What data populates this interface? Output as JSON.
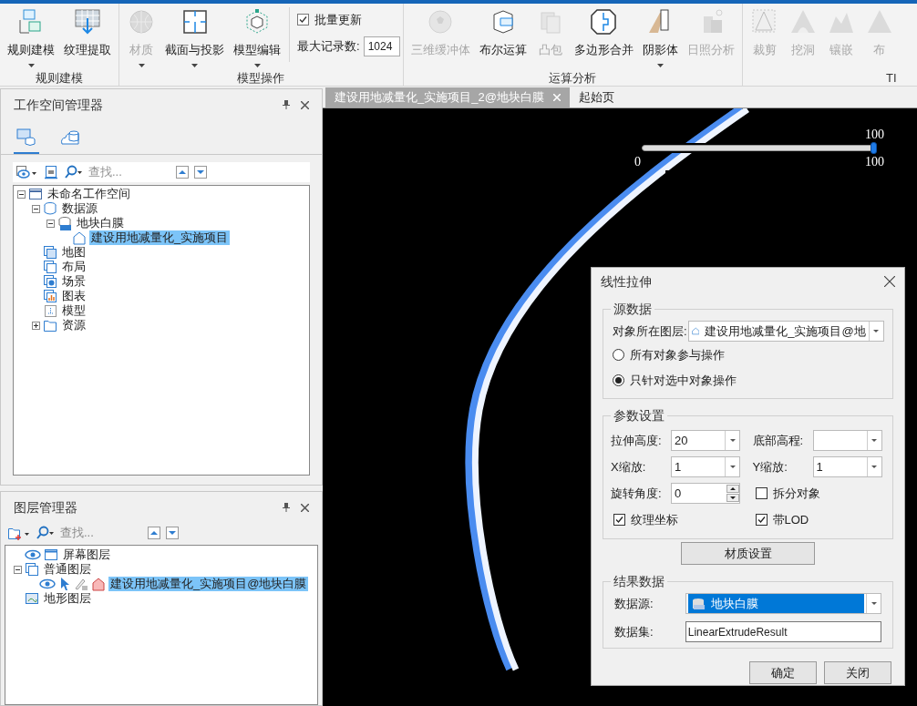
{
  "ribbon": {
    "groups": [
      {
        "label": "规则建模",
        "buttons": [
          {
            "label": "规则建模",
            "disabled": false,
            "dropdown": true
          },
          {
            "label": "纹理提取",
            "disabled": false,
            "dropdown": false
          }
        ]
      },
      {
        "label": "模型操作",
        "buttons": [
          {
            "label": "材质",
            "disabled": true,
            "dropdown": true
          },
          {
            "label": "截面与投影",
            "disabled": false,
            "dropdown": true
          },
          {
            "label": "模型编辑",
            "disabled": false,
            "dropdown": true
          }
        ],
        "batch_update": {
          "label": "批量更新",
          "checked": true
        },
        "max_records": {
          "label": "最大记录数:",
          "value": "1024"
        }
      },
      {
        "label": "运算分析",
        "buttons": [
          {
            "label": "三维缓冲体",
            "disabled": true,
            "dropdown": false
          },
          {
            "label": "布尔运算",
            "disabled": false,
            "dropdown": false
          },
          {
            "label": "凸包",
            "disabled": true,
            "dropdown": false
          },
          {
            "label": "多边形合并",
            "disabled": false,
            "dropdown": false
          },
          {
            "label": "阴影体",
            "disabled": false,
            "dropdown": true
          },
          {
            "label": "日照分析",
            "disabled": true,
            "dropdown": false
          }
        ]
      },
      {
        "label": "TI",
        "buttons": [
          {
            "label": "裁剪",
            "disabled": true,
            "dropdown": false
          },
          {
            "label": "挖洞",
            "disabled": true,
            "dropdown": false
          },
          {
            "label": "镶嵌",
            "disabled": true,
            "dropdown": false
          },
          {
            "label": "布",
            "disabled": true,
            "dropdown": false
          }
        ]
      }
    ]
  },
  "workspace_panel": {
    "title": "工作空间管理器",
    "view_tabs": [
      {
        "selected": true
      },
      {
        "selected": false
      }
    ],
    "search": {
      "placeholder": "查找..."
    },
    "tree": [
      {
        "label": "未命名工作空间",
        "expanded": true,
        "selected": false,
        "children": [
          {
            "label": "数据源",
            "expanded": true,
            "selected": false,
            "children": [
              {
                "label": "地块白膜",
                "expanded": true,
                "selected": false,
                "children": [
                  {
                    "label": "建设用地减量化_实施项目",
                    "selected": true
                  }
                ]
              }
            ]
          },
          {
            "label": "地图",
            "selected": false
          },
          {
            "label": "布局",
            "selected": false
          },
          {
            "label": "场景",
            "selected": false
          },
          {
            "label": "图表",
            "selected": false
          },
          {
            "label": "模型",
            "selected": false
          },
          {
            "label": "资源",
            "expanded": false,
            "selected": false
          }
        ]
      }
    ]
  },
  "layer_panel": {
    "title": "图层管理器",
    "search": {
      "placeholder": "查找..."
    },
    "tree": [
      {
        "label": "屏幕图层",
        "selected": false
      },
      {
        "label": "普通图层",
        "expanded": true,
        "selected": false,
        "children": [
          {
            "label": "建设用地减量化_实施项目@地块白膜",
            "selected": true
          }
        ]
      },
      {
        "label": "地形图层",
        "selected": false
      }
    ]
  },
  "document_tabs": [
    {
      "label": "建设用地减量化_实施项目_2@地块白膜",
      "selected": true
    },
    {
      "label": "起始页",
      "selected": false
    }
  ],
  "scene": {
    "slider": {
      "level": 1,
      "value_label": "100",
      "min_label": "0",
      "max_label": "100"
    }
  },
  "dialog": {
    "title": "线性拉伸",
    "source": {
      "title": "源数据",
      "layer_label": "对象所在图层:",
      "layer_value": "建设用地减量化_实施项目@地",
      "options": [
        {
          "label": "所有对象参与操作",
          "selected": false
        },
        {
          "label": "只针对选中对象操作",
          "selected": true
        }
      ]
    },
    "params": {
      "title": "参数设置",
      "fields": [
        {
          "kind": "combo",
          "label": "拉伸高度:",
          "value": "20"
        },
        {
          "kind": "combo",
          "label": "底部高程:"
        },
        {
          "kind": "combo",
          "label": "X缩放:",
          "value": "1"
        },
        {
          "kind": "combo",
          "label": "Y缩放:",
          "value": "1"
        },
        {
          "kind": "spin",
          "label": "旋转角度:",
          "value": "0"
        },
        {
          "kind": "checkbox",
          "label": "拆分对象",
          "checked": false
        },
        {
          "kind": "checkbox",
          "label": "纹理坐标",
          "checked": true
        },
        {
          "kind": "checkbox",
          "label": "带LOD",
          "checked": true
        }
      ]
    },
    "material_button": "材质设置",
    "result": {
      "title": "结果数据",
      "datasource_label": "数据源:",
      "datasource_value": "地块白膜",
      "dataset_label": "数据集:",
      "dataset_value": "LinearExtrudeResult"
    },
    "buttons": [
      "确定",
      "关闭"
    ]
  }
}
